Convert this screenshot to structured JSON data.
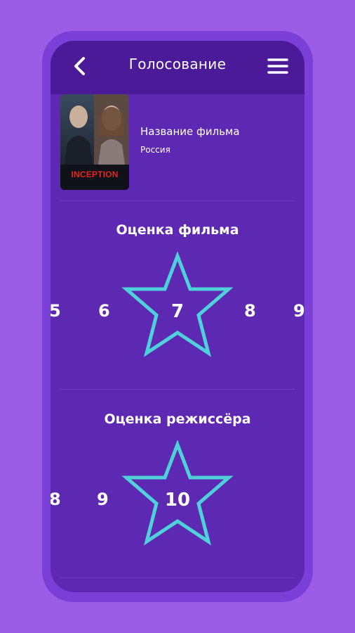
{
  "header": {
    "title": "Голосование",
    "back_icon": "chevron-left-icon",
    "menu_icon": "hamburger-icon"
  },
  "movie": {
    "poster_title": "INCEPTION",
    "name": "Название фильма",
    "country": "Россия"
  },
  "film_rating": {
    "title": "Оценка фильма",
    "options": [
      "5",
      "6",
      "7",
      "8",
      "9"
    ],
    "selected": "7"
  },
  "director_rating": {
    "title": "Оценка режиссёра",
    "options": [
      "8",
      "9",
      "10"
    ],
    "selected": "10"
  },
  "colors": {
    "background": "#9b5de5",
    "screen": "#5d28b2",
    "topbar": "#4a1a98",
    "star": "#4fd1d9"
  }
}
